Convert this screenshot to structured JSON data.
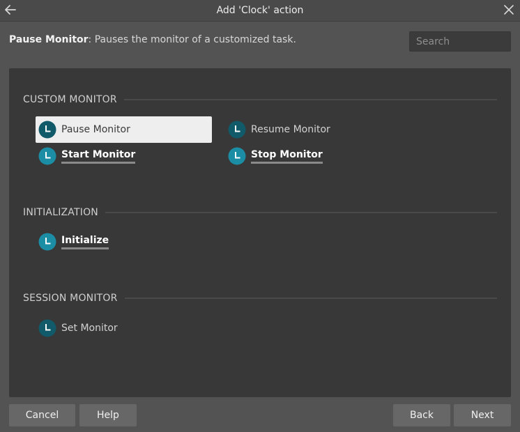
{
  "window": {
    "title": "Add 'Clock' action"
  },
  "description": {
    "name": "Pause Monitor",
    "text": ": Pauses the monitor of a customized task."
  },
  "search": {
    "placeholder": "Search",
    "value": ""
  },
  "sections": [
    {
      "label": "CUSTOM MONITOR",
      "items": [
        {
          "label": "Pause Monitor",
          "selected": true,
          "icon": "clock-icon"
        },
        {
          "label": "Resume Monitor",
          "icon": "clock-icon"
        },
        {
          "label": "Start Monitor",
          "icon": "clock-icon"
        },
        {
          "label": "Stop Monitor",
          "icon": "clock-icon"
        }
      ]
    },
    {
      "label": "INITIALIZATION",
      "items": [
        {
          "label": "Initialize",
          "icon": "clock-icon"
        }
      ]
    },
    {
      "label": "SESSION MONITOR",
      "items": [
        {
          "label": "Set Monitor",
          "icon": "clock-icon"
        }
      ]
    }
  ],
  "buttons": {
    "cancel": "Cancel",
    "help": "Help",
    "back": "Back",
    "next": "Next"
  },
  "colors": {
    "icon_dark": "#115a69",
    "icon_bright": "#1b8da5",
    "selected_bg": "#eeeeee",
    "panel_bg": "#383838",
    "window_bg": "#535353"
  }
}
